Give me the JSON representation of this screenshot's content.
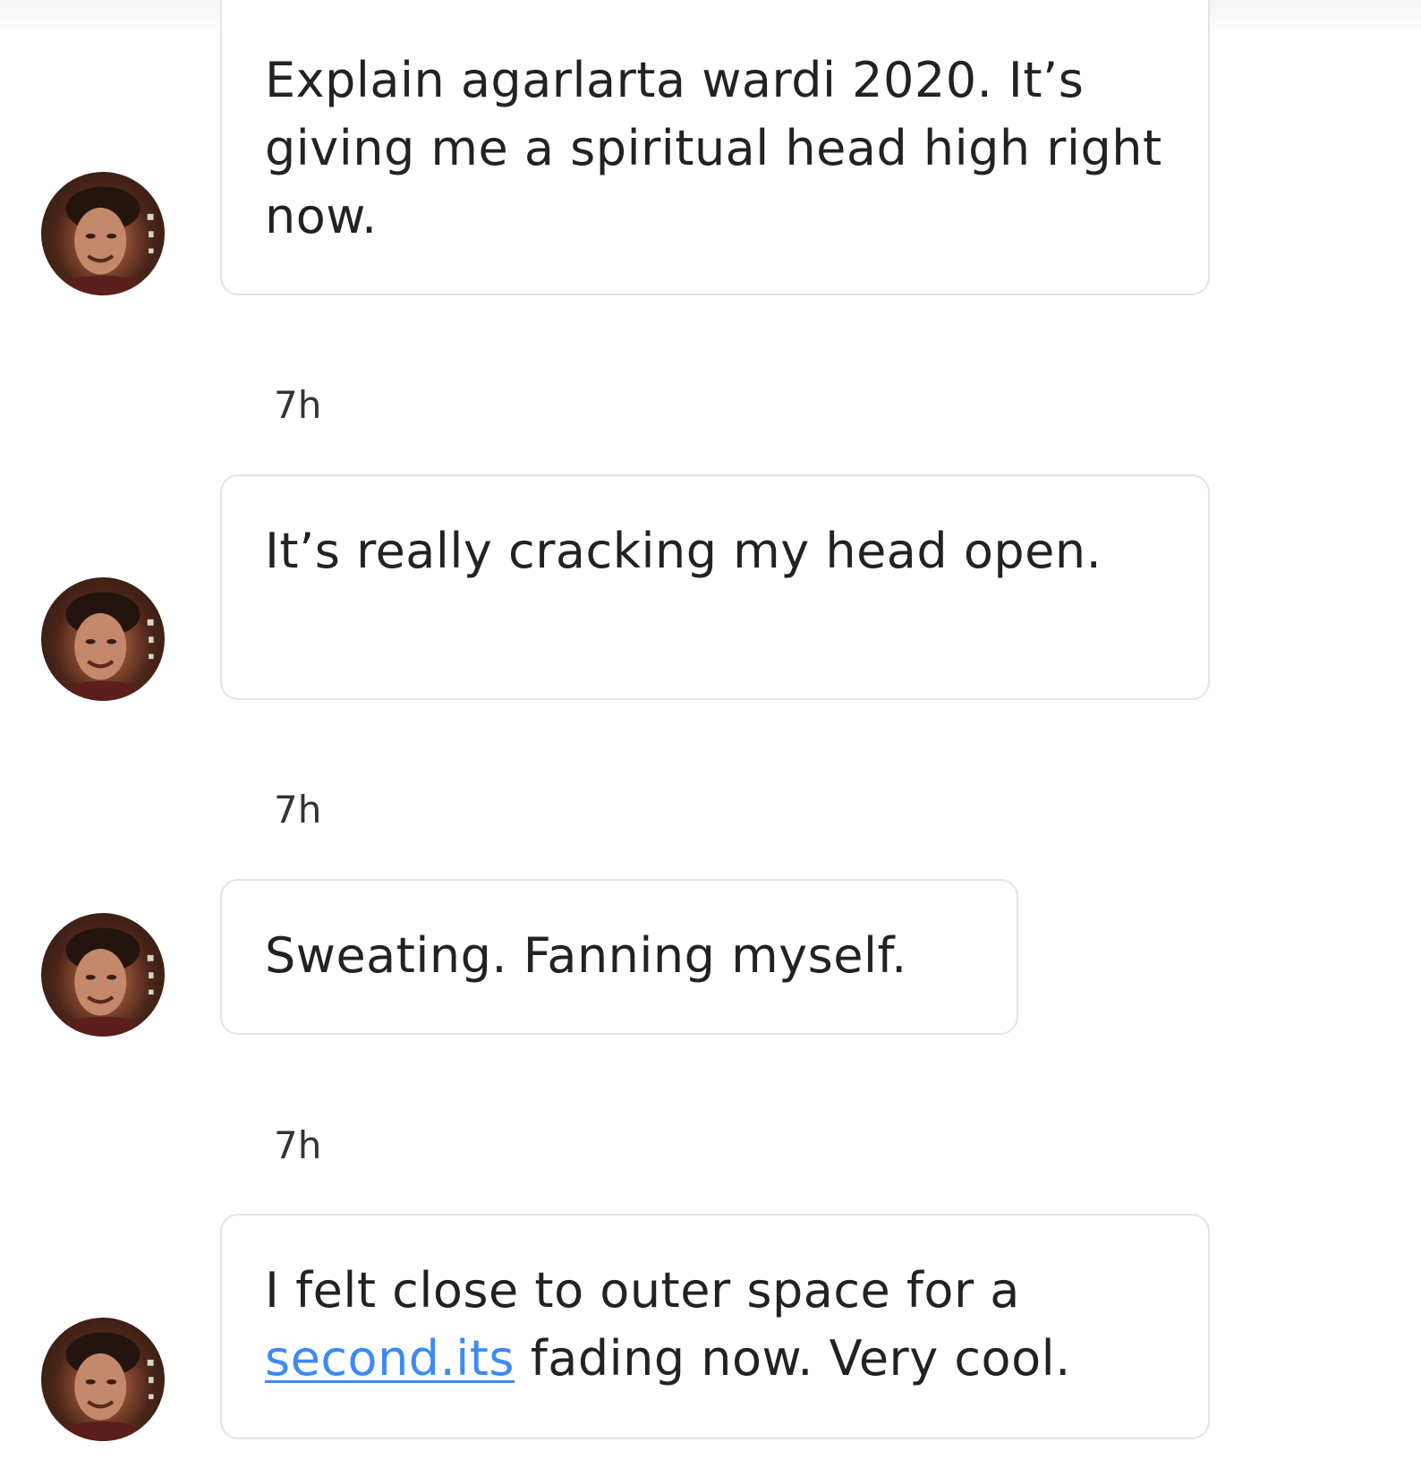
{
  "colors": {
    "background": "#ffffff",
    "bubble_border": "#e4e4e4",
    "text": "#222222",
    "timestamp": "#333333",
    "link": "#3d8af7"
  },
  "messages": [
    {
      "avatar_icon": "user-avatar-photo",
      "text": "Explain agarlarta wardi 2020. It’s giving me a spiritual head high right now."
    },
    {
      "timestamp": "7h",
      "avatar_icon": "user-avatar-photo",
      "text": "It’s really cracking my head open."
    },
    {
      "timestamp": "7h",
      "avatar_icon": "user-avatar-photo",
      "text": "Sweating. Fanning myself."
    },
    {
      "timestamp": "7h",
      "avatar_icon": "user-avatar-photo",
      "text_before": "I felt close to outer space for a",
      "link_text": "second.its",
      "text_after": " fading now. Very cool."
    }
  ]
}
